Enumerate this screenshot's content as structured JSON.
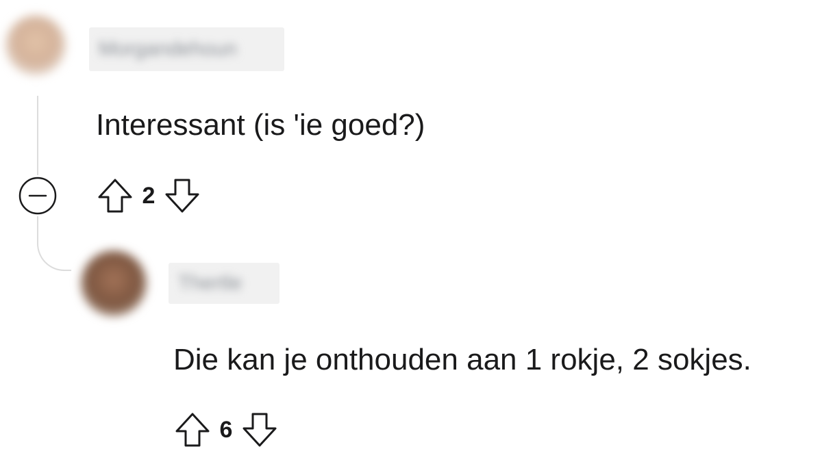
{
  "comments": [
    {
      "username": "Morgandehoun",
      "body": "Interessant (is 'ie goed?)",
      "score": "2",
      "avatar_color": "#d4b29a"
    },
    {
      "username": "Thertle",
      "body": "Die kan je onthouden aan 1 rokje, 2 sokjes.",
      "score": "6",
      "avatar_color": "#8a6248"
    }
  ],
  "icons": {
    "upvote": "arrow-up-outline",
    "downvote": "arrow-down-outline",
    "collapse": "circle-minus"
  }
}
